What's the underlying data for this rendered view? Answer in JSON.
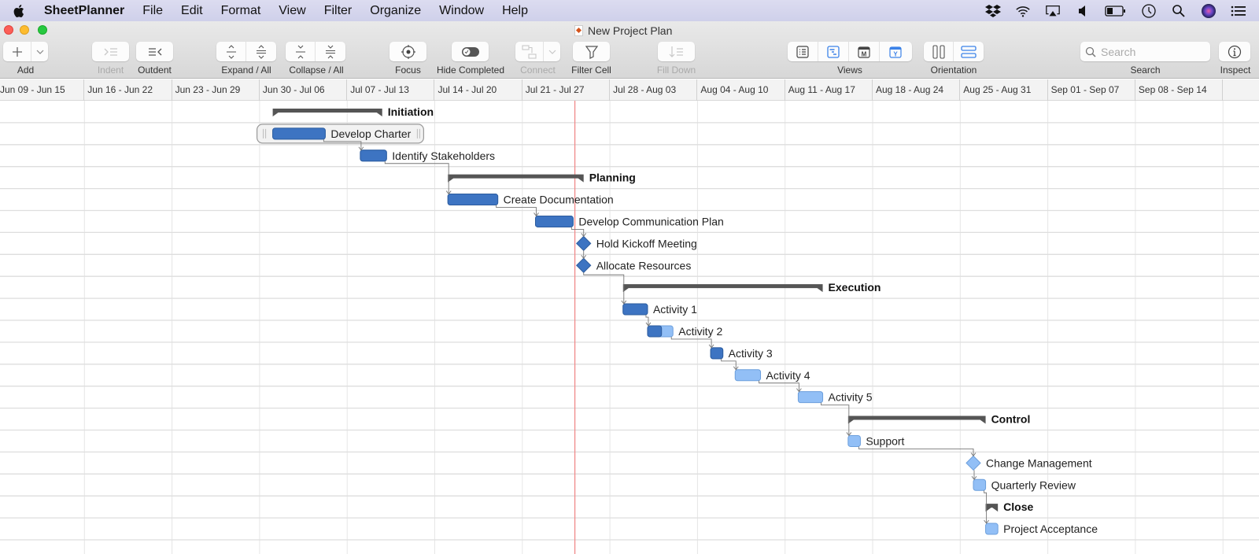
{
  "menubar": {
    "app_name": "SheetPlanner",
    "items": [
      "File",
      "Edit",
      "Format",
      "View",
      "Filter",
      "Organize",
      "Window",
      "Help"
    ],
    "status_icons": [
      "dropbox-icon",
      "wifi-icon",
      "airplay-icon",
      "volume-icon",
      "battery-icon",
      "time-machine-icon",
      "spotlight-search-icon",
      "siri-icon",
      "notification-center-icon"
    ]
  },
  "window": {
    "title": "New Project Plan"
  },
  "toolbar": {
    "add_label": "Add",
    "indent_label": "Indent",
    "outdent_label": "Outdent",
    "expand_label": "Expand / All",
    "collapse_label": "Collapse / All",
    "focus_label": "Focus",
    "hide_completed_label": "Hide Completed",
    "connect_label": "Connect",
    "filter_cell_label": "Filter Cell",
    "fill_down_label": "Fill Down",
    "views_label": "Views",
    "orientation_label": "Orientation",
    "search_label": "Search",
    "search_placeholder": "Search",
    "search_value": "",
    "inspect_label": "Inspect",
    "views": [
      "outline-view-icon",
      "gantt-view-icon",
      "month-calendar-icon",
      "year-calendar-icon"
    ],
    "active_view": "year-calendar-icon"
  },
  "timeline": {
    "weeks": [
      "Jun 09 - Jun 15",
      "Jun 16 - Jun 22",
      "Jun 23 - Jun 29",
      "Jun 30 - Jul 06",
      "Jul 07 - Jul 13",
      "Jul 14 - Jul 20",
      "Jul 21 - Jul 27",
      "Jul 28 - Aug 03",
      "Aug 04 - Aug 10",
      "Aug 11 - Aug 17",
      "Aug 18 - Aug 24",
      "Aug 25 - Aug 31",
      "Sep 01 - Sep 07",
      "Sep 08 - Sep 14"
    ],
    "today_week_index": 6,
    "today_offset_in_week": 0.6
  },
  "colors": {
    "task_done": "#3d74c2",
    "task_pending": "#92bff6",
    "group_bar": "#555555",
    "today_line": "#f08a8a",
    "connector": "#777777"
  },
  "tasks": [
    {
      "name": "Initiation",
      "type": "group",
      "start": 3.15,
      "end": 4.4
    },
    {
      "name": "Develop Charter",
      "type": "task",
      "start": 3.15,
      "end": 3.75,
      "progress": 1,
      "selected": true
    },
    {
      "name": "Identify Stakeholders",
      "type": "task",
      "start": 4.15,
      "end": 4.45,
      "progress": 1
    },
    {
      "name": "Planning",
      "type": "group",
      "start": 5.15,
      "end": 6.7
    },
    {
      "name": "Create Documentation",
      "type": "task",
      "start": 5.15,
      "end": 5.72,
      "progress": 1
    },
    {
      "name": "Develop Communication Plan",
      "type": "task",
      "start": 6.15,
      "end": 6.58,
      "progress": 1
    },
    {
      "name": "Hold Kickoff Meeting",
      "type": "milestone",
      "start": 6.7,
      "progress": 1
    },
    {
      "name": "Allocate Resources",
      "type": "milestone",
      "start": 6.7,
      "progress": 1
    },
    {
      "name": "Execution",
      "type": "group",
      "start": 7.15,
      "end": 9.43
    },
    {
      "name": "Activity 1",
      "type": "task",
      "start": 7.15,
      "end": 7.43,
      "progress": 1
    },
    {
      "name": "Activity 2",
      "type": "task",
      "start": 7.43,
      "end": 7.72,
      "progress": 0.55
    },
    {
      "name": "Activity 3",
      "type": "task",
      "start": 8.15,
      "end": 8.29,
      "progress": 1
    },
    {
      "name": "Activity 4",
      "type": "task",
      "start": 8.43,
      "end": 8.72,
      "progress": 0
    },
    {
      "name": "Activity 5",
      "type": "task",
      "start": 9.15,
      "end": 9.43,
      "progress": 0
    },
    {
      "name": "Control",
      "type": "group",
      "start": 9.72,
      "end": 11.29
    },
    {
      "name": "Support",
      "type": "task",
      "start": 9.72,
      "end": 9.86,
      "progress": 0
    },
    {
      "name": "Change Management",
      "type": "milestone",
      "start": 11.15,
      "progress": 0
    },
    {
      "name": "Quarterly Review",
      "type": "task",
      "start": 11.15,
      "end": 11.29,
      "progress": 0
    },
    {
      "name": "Close",
      "type": "group",
      "start": 11.29,
      "end": 11.43
    },
    {
      "name": "Project Acceptance",
      "type": "task",
      "start": 11.29,
      "end": 11.43,
      "progress": 0
    }
  ],
  "dependencies": [
    [
      1,
      2
    ],
    [
      2,
      4
    ],
    [
      4,
      5
    ],
    [
      5,
      6
    ],
    [
      6,
      7
    ],
    [
      7,
      9
    ],
    [
      9,
      10
    ],
    [
      10,
      11
    ],
    [
      11,
      12
    ],
    [
      12,
      13
    ],
    [
      13,
      15
    ],
    [
      15,
      16
    ],
    [
      16,
      17
    ],
    [
      17,
      19
    ]
  ]
}
